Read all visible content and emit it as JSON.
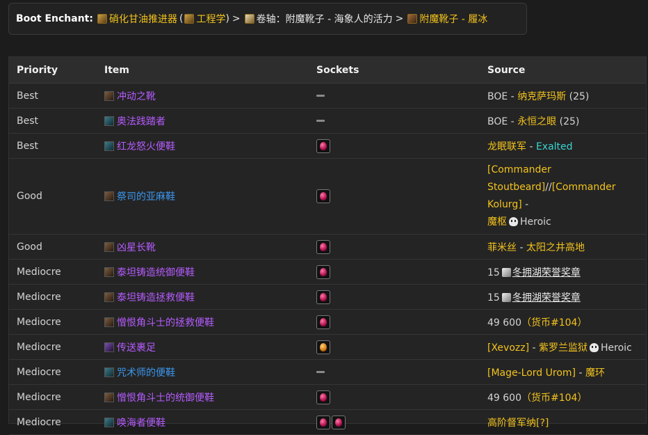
{
  "enchant": {
    "label": "Boot Enchant:",
    "engine_name": "硝化甘油推进器",
    "paren_open": "(",
    "engineering": "工程学",
    "paren_close": ")",
    "sep1": ">",
    "scroll_name": "卷轴：附魔靴子 - 海象人的活力",
    "sep2": ">",
    "formula_name": "附魔靴子 - 履冰"
  },
  "table": {
    "headers": {
      "priority": "Priority",
      "item": "Item",
      "sockets": "Sockets",
      "source": "Source"
    },
    "rows": [
      {
        "priority": "Best",
        "item": "冲动之靴",
        "quality": "epic",
        "sockets": 0,
        "src": {
          "a": "BOE",
          "sep": " - ",
          "b": "纳克萨玛斯",
          "c": "(25)"
        }
      },
      {
        "priority": "Best",
        "item": "奥法践踏者",
        "quality": "epic",
        "sockets": 0,
        "src": {
          "a": "BOE",
          "sep": " - ",
          "b": "永恒之眼",
          "c": "(25)"
        }
      },
      {
        "priority": "Best",
        "item": "红龙怒火便鞋",
        "quality": "epic",
        "sockets": 1,
        "src": {
          "a": "龙眠联军",
          "sep": " - ",
          "b": "Exalted"
        }
      },
      {
        "priority": "Good",
        "item": "祭司的亚麻鞋",
        "quality": "rare",
        "sockets": 1,
        "src": {
          "l1": "[Commander",
          "l2a": "Stoutbeard]",
          "l2b": "//",
          "l2c": "[Commander Kolurg]",
          "l2d": " -",
          "l3a": "魔枢",
          "l3b": "Heroic"
        }
      },
      {
        "priority": "Good",
        "item": "凶星长靴",
        "quality": "epic",
        "sockets": 1,
        "src": {
          "a": "菲米丝",
          "sep": " - ",
          "b": "太阳之井高地"
        }
      },
      {
        "priority": "Mediocre",
        "item": "泰坦铸造统御便鞋",
        "quality": "epic",
        "sockets": 1,
        "src": {
          "count": "15",
          "token": "冬拥湖荣誉奖章"
        }
      },
      {
        "priority": "Mediocre",
        "item": "泰坦铸造拯救便鞋",
        "quality": "epic",
        "sockets": 1,
        "src": {
          "count": "15",
          "token": "冬拥湖荣誉奖章"
        }
      },
      {
        "priority": "Mediocre",
        "item": "憎恨角斗士的拯救便鞋",
        "quality": "epic",
        "sockets": 1,
        "src": {
          "count": "49 600",
          "cur": "（货币#104）"
        }
      },
      {
        "priority": "Mediocre",
        "item": "传送裹足",
        "quality": "epic",
        "sockets": 1,
        "gem": "amber",
        "src": {
          "a": "[Xevozz]",
          "sep": " - ",
          "b": "紫罗兰监狱",
          "c": "Heroic"
        }
      },
      {
        "priority": "Mediocre",
        "item": "咒术师的便鞋",
        "quality": "rare",
        "sockets": 0,
        "src": {
          "a": "[Mage-Lord Urom]",
          "sep": " - ",
          "b": "魔环"
        }
      },
      {
        "priority": "Mediocre",
        "item": "憎恨角斗士的统御便鞋",
        "quality": "epic",
        "sockets": 1,
        "src": {
          "count": "49 600",
          "cur": "（货币#104）"
        }
      },
      {
        "priority": "Mediocre",
        "item": "唤海者便鞋",
        "quality": "epic",
        "sockets": 2,
        "src": {
          "a": "高阶督军纳[?]"
        }
      }
    ]
  }
}
